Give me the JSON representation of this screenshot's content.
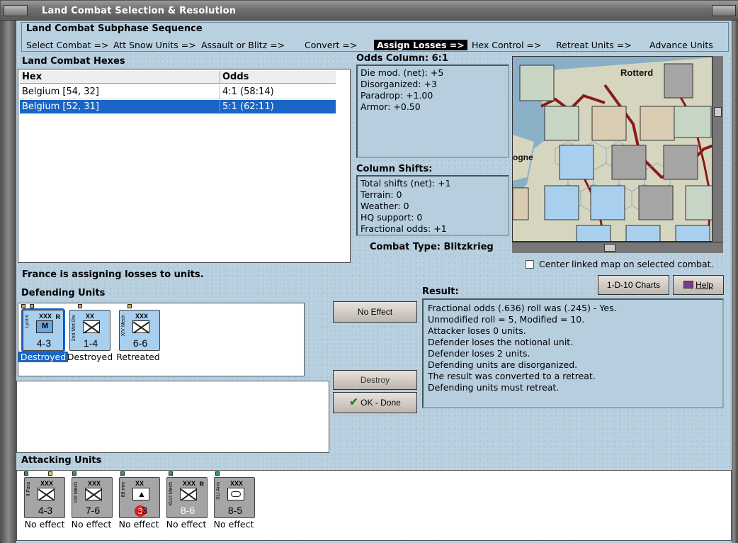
{
  "window": {
    "title": "Land Combat Selection & Resolution"
  },
  "sequence": {
    "title": "Land Combat Subphase Sequence",
    "steps": [
      "Select Combat =>",
      "Att Snow Units =>",
      "Assault or Blitz =>",
      "Convert =>",
      "Assign Losses =>",
      "Hex Control =>",
      "Retreat Units =>",
      "Advance Units"
    ],
    "active_step": "Assign Losses =>"
  },
  "hexes": {
    "title": "Land Combat Hexes",
    "columns": [
      "Hex",
      "Odds"
    ],
    "rows": [
      {
        "hex": "Belgium [54, 32]",
        "odds": "4:1 (58:14)",
        "selected": false
      },
      {
        "hex": "Belgium [52, 31]",
        "odds": "5:1 (62:11)",
        "selected": true
      }
    ]
  },
  "odds": {
    "title": "Odds Column: 6:1",
    "lines": [
      "Die mod. (net): +5",
      "Disorganized: +3",
      "Paradrop: +1.00",
      "Armor: +0.50"
    ]
  },
  "shifts": {
    "title": "Column Shifts:",
    "lines": [
      "Total shifts (net): +1",
      "Terrain: 0",
      "Weather: 0",
      "HQ support: 0",
      "Fractional odds: +1"
    ]
  },
  "combat_type": "Combat Type:  Blitzkrieg",
  "map": {
    "city_label": "Rotterd",
    "label_ogne": "ogne",
    "colors": {
      "sea": "#8ab0c8",
      "land": "#d6d6c0",
      "border": "#8b1a1a"
    }
  },
  "center_linked": {
    "label": "Center linked map on selected combat.",
    "checked": false
  },
  "status_message": "France is assigning losses to units.",
  "defending": {
    "title": "Defending Units",
    "units": [
      {
        "size": "XXX",
        "name": "Lyons",
        "strength": "4-3",
        "tag": "R",
        "result": "Destroyed",
        "selected": true
      },
      {
        "size": "XX",
        "name": "2nd Mot Div",
        "strength": "1-4",
        "tag": "",
        "result": "Destroyed",
        "selected": false
      },
      {
        "size": "XXX",
        "name": "XIV Mech",
        "strength": "6-6",
        "tag": "",
        "result": "Retreated",
        "selected": false
      }
    ]
  },
  "buttons": {
    "no_effect": "No Effect",
    "destroy": "Destroy",
    "ok_done": "OK - Done",
    "charts": "1-D-10 Charts",
    "help": "Help"
  },
  "result": {
    "title": "Result:",
    "lines": [
      "Fractional odds (.636) roll was (.245)  - Yes.",
      "Unmodified roll = 5, Modified = 10.",
      "Attacker loses 0 units.",
      "Defender loses the notional unit.",
      "Defender loses 2 units.",
      "Defending units are disorganized.",
      "The result was converted to a retreat.",
      "Defending units must retreat."
    ]
  },
  "attacking": {
    "title": "Attacking Units",
    "units": [
      {
        "size": "XXX",
        "name": "II Para",
        "strength": "4-3",
        "tag": "",
        "result": "No effect"
      },
      {
        "size": "XXX",
        "name": "VIII Mech",
        "strength": "7-6",
        "tag": "",
        "result": "No effect"
      },
      {
        "size": "XX",
        "name": "88 mm",
        "strength": "3-3",
        "tag": "",
        "result": "No effect"
      },
      {
        "size": "XXX",
        "name": "XLVI Mech",
        "strength": "8-6",
        "tag": "R",
        "result": "No effect"
      },
      {
        "size": "XXX",
        "name": "XLI Arm",
        "strength": "8-5",
        "tag": "",
        "result": "No effect"
      }
    ]
  }
}
